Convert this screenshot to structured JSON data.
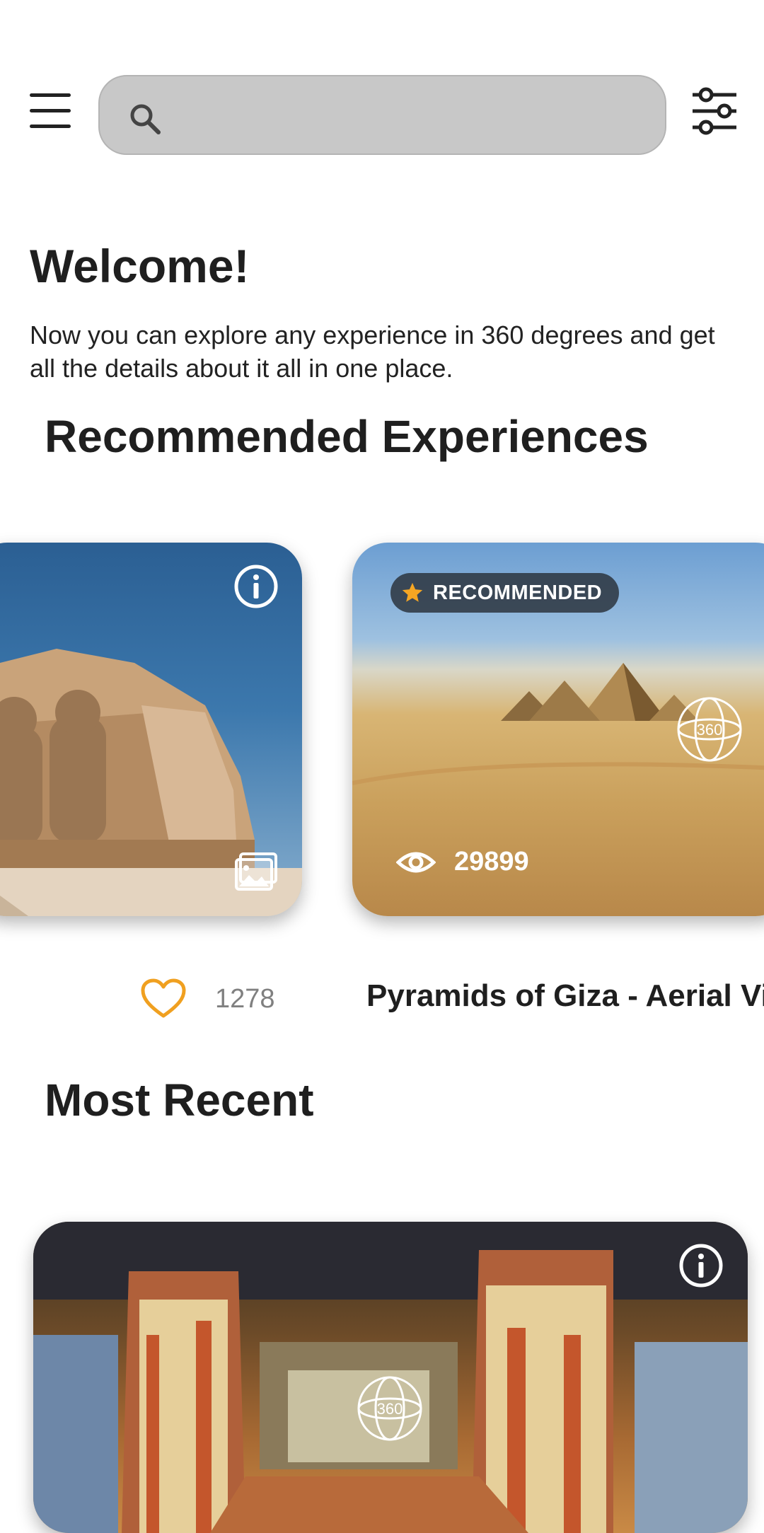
{
  "search": {
    "placeholder": ""
  },
  "welcome": {
    "title": "Welcome!",
    "text": "Now you can explore any experience in 360 degrees and get all the details about it all in one place."
  },
  "recommended": {
    "title": "Recommended Experiences",
    "cards": [
      {
        "image": "abu-simbel-temple",
        "likes": "1278",
        "icons": [
          "info-icon",
          "gallery-icon",
          "heart-icon"
        ]
      },
      {
        "image": "pyramids-of-giza",
        "badge": "RECOMMENDED",
        "views": "29899",
        "title": "Pyramids of Giza - Aerial Vi",
        "icons": [
          "star-icon",
          "360-icon",
          "eye-icon"
        ]
      }
    ]
  },
  "recent": {
    "title": "Most Recent",
    "cards": [
      {
        "image": "tomb-interior",
        "icons": [
          "info-icon",
          "360-icon"
        ]
      }
    ]
  },
  "colors": {
    "accent": "#f0a020",
    "search_bg": "#c8c8c8",
    "text": "#1f1f1f",
    "muted": "#808080"
  }
}
